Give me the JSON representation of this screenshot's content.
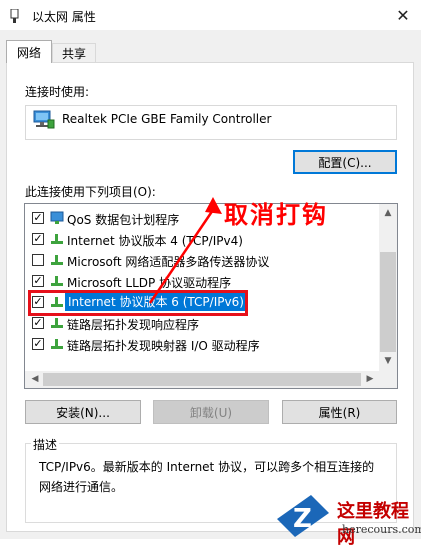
{
  "window": {
    "title": "以太网 属性",
    "close_glyph": "✕"
  },
  "tabs": [
    {
      "label": "网络",
      "active": true
    },
    {
      "label": "共享",
      "active": false
    }
  ],
  "connect_using_label": "连接时使用:",
  "adapter": {
    "name": "Realtek PCIe GBE Family Controller",
    "icon": "network-adapter-icon"
  },
  "buttons": {
    "configure": "配置(C)...",
    "install": "安装(N)...",
    "uninstall": "卸载(U)",
    "properties": "属性(R)"
  },
  "items_label": "此连接使用下列项目(O):",
  "items": [
    {
      "label": "QoS 数据包计划程序",
      "checked": true,
      "icon": "qos-icon"
    },
    {
      "label": "Internet 协议版本 4 (TCP/IPv4)",
      "checked": true,
      "icon": "protocol-icon"
    },
    {
      "label": "Microsoft 网络适配器多路传送器协议",
      "checked": false,
      "icon": "protocol-icon"
    },
    {
      "label": "Microsoft LLDP 协议驱动程序",
      "checked": true,
      "icon": "protocol-icon"
    },
    {
      "label": "Internet 协议版本 6 (TCP/IPv6)",
      "checked": true,
      "selected": true,
      "icon": "protocol-icon"
    },
    {
      "label": "链路层拓扑发现响应程序",
      "checked": true,
      "icon": "protocol-icon"
    },
    {
      "label": "链路层拓扑发现映射器 I/O 驱动程序",
      "checked": true,
      "icon": "protocol-icon"
    }
  ],
  "description": {
    "heading": "描述",
    "text": "TCP/IPv6。最新版本的 Internet 协议，可以跨多个相互连接的网络进行通信。"
  },
  "annotation": {
    "text": "取消打钩",
    "color": "#ff0000"
  },
  "watermark": {
    "title": "这里教程网",
    "url": "herecours.com"
  },
  "colors": {
    "selection": "#0078d7",
    "highlight_box": "#e6101a",
    "accent": "#0078d7"
  }
}
